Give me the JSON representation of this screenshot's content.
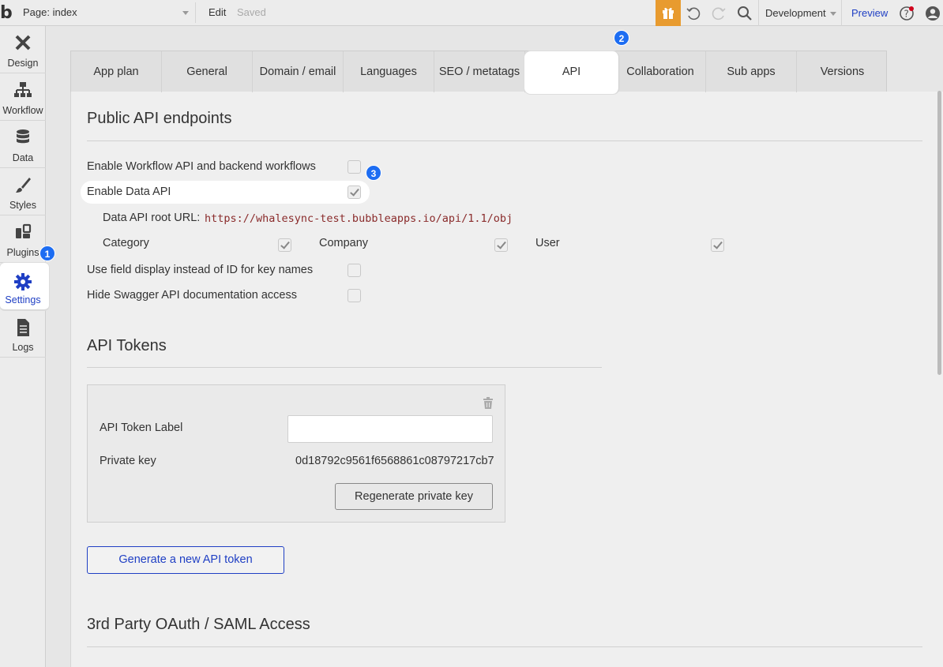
{
  "topbar": {
    "logo": "b",
    "page_select": "Page: index",
    "edit": "Edit",
    "saved": "Saved",
    "environment": "Development",
    "preview": "Preview"
  },
  "sidebar": {
    "items": [
      {
        "label": "Design",
        "icon": "design-icon"
      },
      {
        "label": "Workflow",
        "icon": "workflow-icon"
      },
      {
        "label": "Data",
        "icon": "database-icon"
      },
      {
        "label": "Styles",
        "icon": "brush-icon"
      },
      {
        "label": "Plugins",
        "icon": "plugin-icon"
      },
      {
        "label": "Settings",
        "icon": "gear-icon",
        "active": true
      },
      {
        "label": "Logs",
        "icon": "document-icon"
      }
    ]
  },
  "badges": [
    "1",
    "2",
    "3"
  ],
  "tabs": [
    {
      "label": "App plan"
    },
    {
      "label": "General"
    },
    {
      "label": "Domain / email"
    },
    {
      "label": "Languages"
    },
    {
      "label": "SEO / metatags"
    },
    {
      "label": "API",
      "active": true
    },
    {
      "label": "Collaboration"
    },
    {
      "label": "Sub apps"
    },
    {
      "label": "Versions"
    }
  ],
  "public_api": {
    "title": "Public API endpoints",
    "workflow_api_label": "Enable Workflow API and backend workflows",
    "workflow_api_checked": false,
    "data_api_label": "Enable Data API",
    "data_api_checked": true,
    "root_url_label": "Data API root URL:",
    "root_url": "https://whalesync-test.bubbleapps.io/api/1.1/obj",
    "types": [
      {
        "label": "Category",
        "checked": true
      },
      {
        "label": "Company",
        "checked": true
      },
      {
        "label": "User",
        "checked": true
      }
    ],
    "field_display_label": "Use field display instead of ID for key names",
    "field_display_checked": false,
    "hide_swagger_label": "Hide Swagger API documentation access",
    "hide_swagger_checked": false
  },
  "api_tokens": {
    "title": "API Tokens",
    "token_label_label": "API Token Label",
    "token_label_value": "",
    "private_key_label": "Private key",
    "private_key_value": "0d18792c9561f6568861c08797217cb7",
    "regenerate_button": "Regenerate private key",
    "generate_button": "Generate a new API token"
  },
  "oauth": {
    "title": "3rd Party OAuth / SAML Access"
  },
  "colors": {
    "accent": "#1f3fc4",
    "badge": "#1d6df2",
    "gift": "#e89b2f"
  }
}
